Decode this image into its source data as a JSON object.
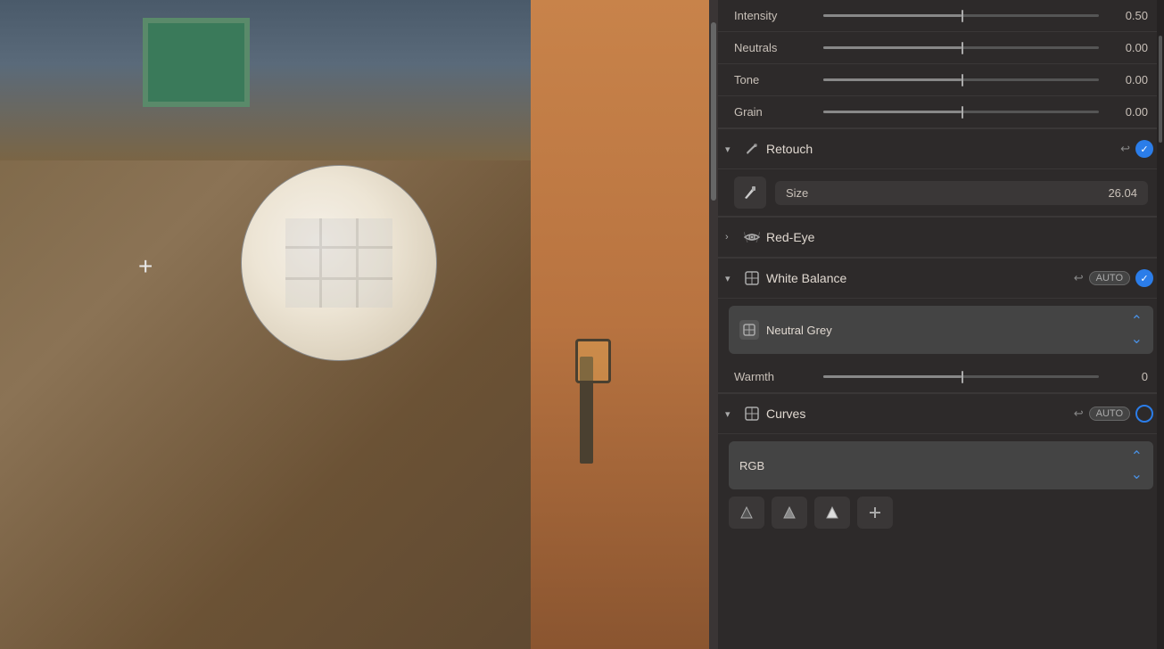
{
  "image": {
    "crosshair": "+"
  },
  "panel": {
    "sliders": [
      {
        "id": "intensity",
        "label": "Intensity",
        "value": "0.50",
        "fill_pct": 50
      },
      {
        "id": "neutrals",
        "label": "Neutrals",
        "value": "0.00",
        "fill_pct": 50
      },
      {
        "id": "tone",
        "label": "Tone",
        "value": "0.00",
        "fill_pct": 50
      },
      {
        "id": "grain",
        "label": "Grain",
        "value": "0.00",
        "fill_pct": 50
      }
    ],
    "sections": {
      "retouch": {
        "title": "Retouch",
        "size_label": "Size",
        "size_value": "26.04",
        "undo": "↩"
      },
      "red_eye": {
        "title": "Red-Eye"
      },
      "white_balance": {
        "title": "White Balance",
        "dropdown_label": "Neutral Grey",
        "warmth_label": "Warmth",
        "warmth_value": "0",
        "undo": "↩",
        "auto_label": "AUTO"
      },
      "curves": {
        "title": "Curves",
        "dropdown_label": "RGB",
        "undo": "↩",
        "auto_label": "AUTO"
      }
    },
    "icons": {
      "retouch": "✂",
      "red_eye": "👁",
      "white_balance": "◪",
      "curves": "◪"
    }
  }
}
